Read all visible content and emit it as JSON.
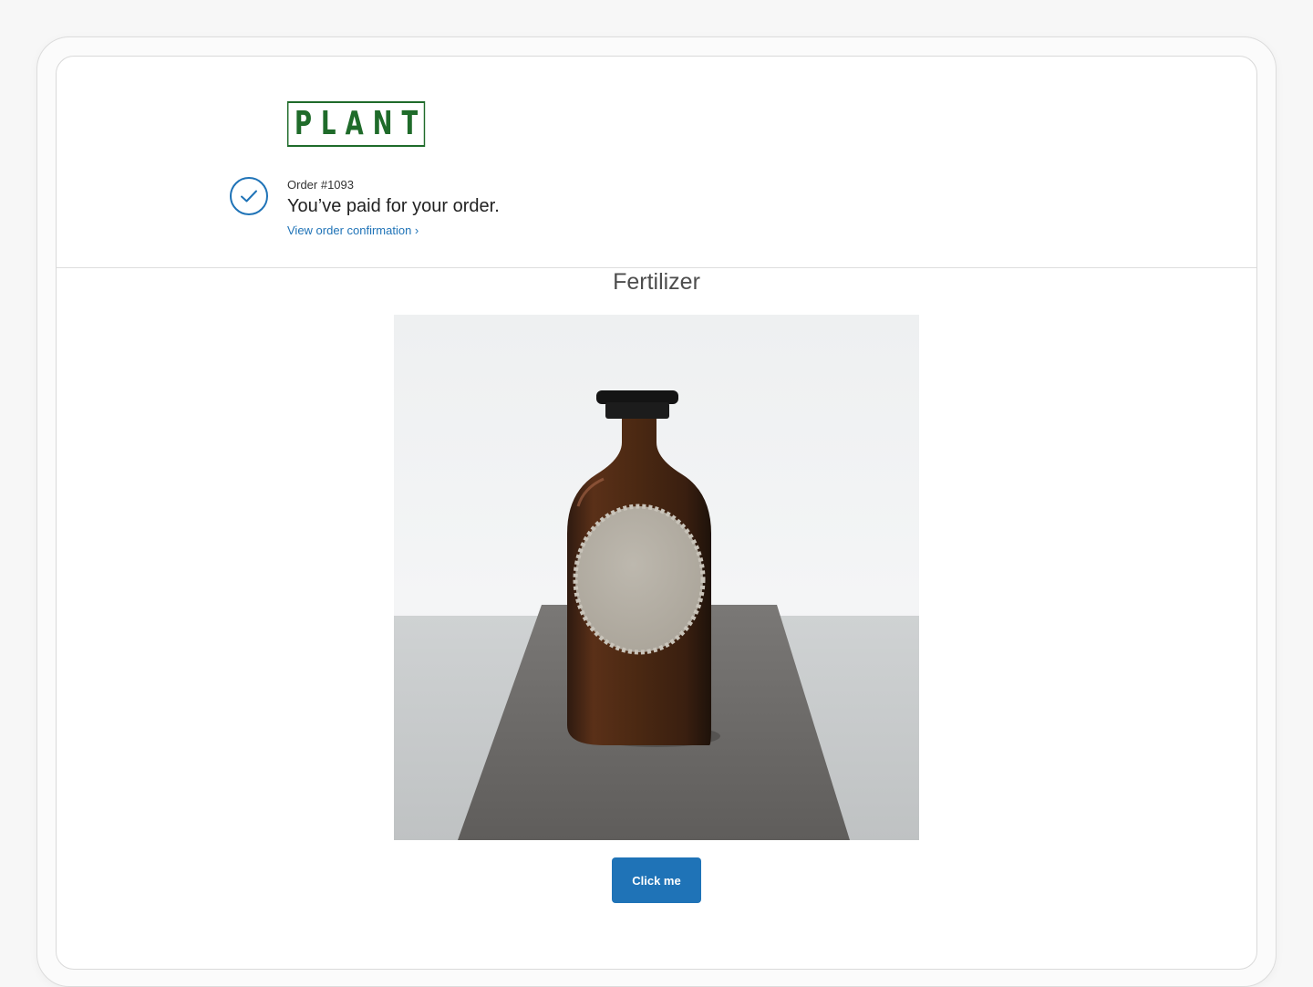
{
  "brand": {
    "logo_text": "PLANT",
    "logo_color": "#1f6b2a"
  },
  "order": {
    "number": "Order #1093",
    "status_title": "You’ve paid for your order.",
    "confirmation_link": "View order confirmation ›",
    "status_icon": "checkmark-circle-icon"
  },
  "product": {
    "title": "Fertilizer",
    "image_alt": "Amber glass bottle with a blank label on a felt runner"
  },
  "cta": {
    "label": "Click me"
  },
  "colors": {
    "accent": "#1f73b7",
    "title_text": "#4d4d4d",
    "body_text": "#222222"
  }
}
